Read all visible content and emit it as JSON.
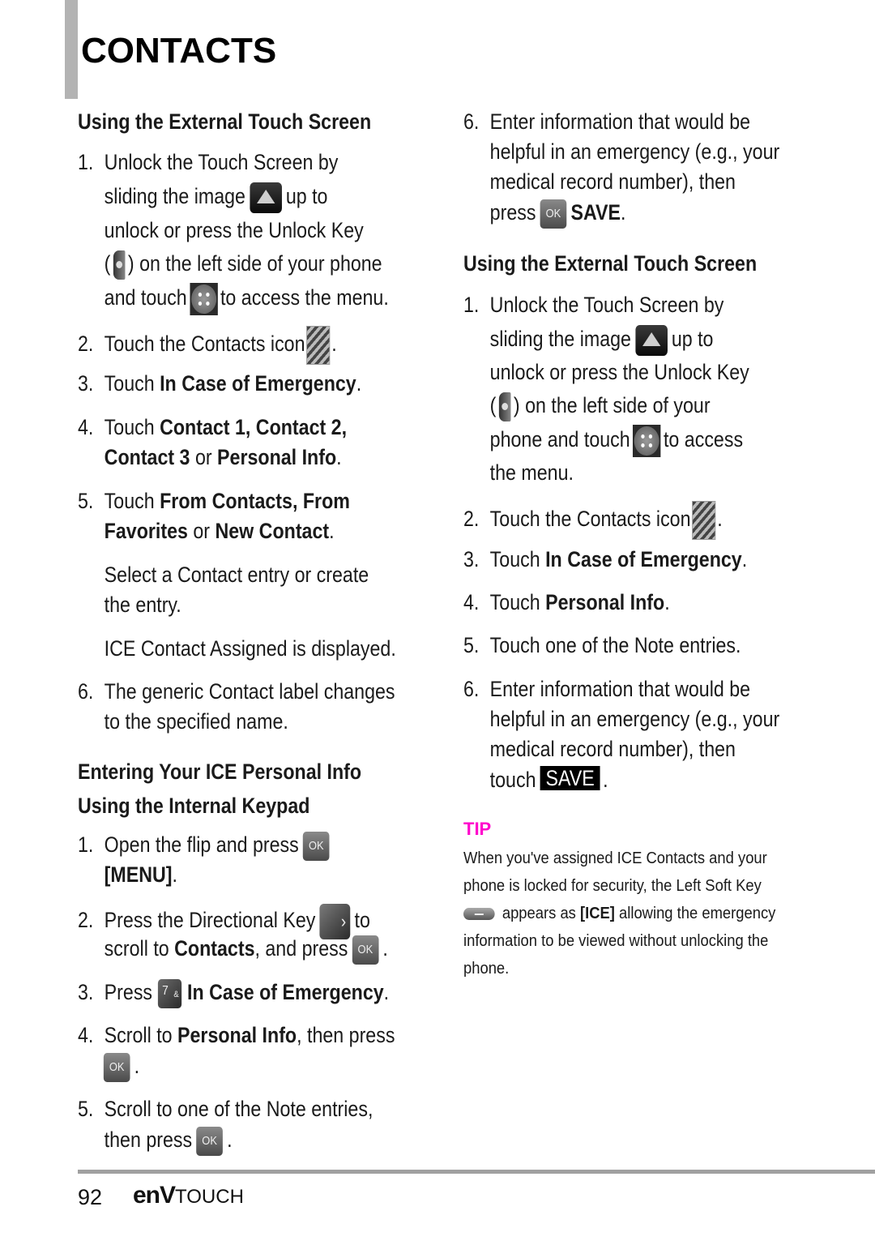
{
  "header": {
    "title": "CONTACTS"
  },
  "left": {
    "section1_title": "Using the External Touch Screen",
    "s1": {
      "n1": "1.",
      "l1": "Unlock the Touch Screen by",
      "l2a": "sliding the image",
      "l2b": "up to",
      "l3": "unlock or press the Unlock Key",
      "l4a": "(",
      "l4b": ") on the left side of your phone",
      "l5a": "and touch",
      "l5b": "to access the menu.",
      "n2": "2.",
      "l6a": "Touch the Contacts icon",
      "l6b": ".",
      "n3": "3.",
      "l7a": "Touch ",
      "l7b": "In Case of Emergency",
      "l7c": ".",
      "n4": "4.",
      "l8a": "Touch ",
      "l8b": "Contact 1, Contact 2,",
      "l9a": "Contact 3",
      "l9b": " or ",
      "l9c": "Personal Info",
      "l9d": ".",
      "n5": "5.",
      "l10a": "Touch ",
      "l10b": "From Contacts, From",
      "l11a": "Favorites",
      "l11b": " or ",
      "l11c": "New Contact",
      "l11d": ".",
      "l12": "Select a Contact entry or create",
      "l13": "the entry.",
      "l14": "ICE Contact Assigned is displayed.",
      "n6": "6.",
      "l15": "The generic Contact label changes",
      "l16": "to the specified name."
    },
    "section2_title_line1": "Entering Your ICE Personal Info",
    "section2_title_line2": "Using the Internal Keypad",
    "s2": {
      "n1": "1.",
      "l1": "Open the flip and press",
      "l2": "[MENU]",
      "l2b": ".",
      "n2": "2.",
      "l3a": "Press the Directional Key",
      "l3b": "to",
      "l4a": "scroll to ",
      "l4b": "Contacts",
      "l4c": ", and press",
      "l4d": ".",
      "n3": "3.",
      "l5a": "Press",
      "l5b": "In Case of Emergency",
      "l5c": ".",
      "n4": "4.",
      "l6a": "Scroll to ",
      "l6b": "Personal Info",
      "l6c": ", then press",
      "l7": ".",
      "n5": "5.",
      "l8": "Scroll to one of the Note entries,",
      "l9a": "then press",
      "l9b": "."
    }
  },
  "right": {
    "s2cont": {
      "n6": "6.",
      "l1": "Enter information that would be",
      "l2": "helpful in an emergency (e.g., your",
      "l3": "medical record number), then",
      "l4a": "press",
      "l4b": "SAVE",
      "l4c": "."
    },
    "section3_title": "Using the External Touch Screen",
    "s3": {
      "n1": "1.",
      "l1": "Unlock the Touch Screen by",
      "l2a": "sliding the image",
      "l2b": "up to",
      "l3": "unlock or press the Unlock Key",
      "l4a": "(",
      "l4b": ") on the left side of your",
      "l5a": "phone and touch",
      "l5b": "to access",
      "l6": "the menu.",
      "n2": "2.",
      "l7a": "Touch the Contacts icon",
      "l7b": ".",
      "n3": "3.",
      "l8a": "Touch ",
      "l8b": "In Case of Emergency",
      "l8c": ".",
      "n4": "4.",
      "l9a": "Touch ",
      "l9b": "Personal Info",
      "l9c": ".",
      "n5": "5.",
      "l10": "Touch one of the Note entries.",
      "n6": "6.",
      "l11": "Enter information that would be",
      "l12": "helpful in an emergency (e.g., your",
      "l13": "medical record number), then",
      "l14a": "touch",
      "l14b": "SAVE",
      "l14c": "."
    },
    "tip": {
      "label": "TIP",
      "line1": "When you've assigned ICE Contacts and your",
      "line2": "phone is locked for security, the Left Soft Key",
      "line3a": "appears as ",
      "line3b": "[ICE]",
      "line3c": " allowing the emergency",
      "line4": "information to be viewed without unlocking the",
      "line5": "phone."
    }
  },
  "icons": {
    "ok_label": "OK",
    "seven_label": "7",
    "seven_sub": "&"
  },
  "footer": {
    "page_number": "92",
    "brand_main": "enV",
    "brand_sub": "TOUCH"
  },
  "colors": {
    "tip": "#ff00cc",
    "rule": "#a0a0a0",
    "side_bar": "#b3b3b3"
  }
}
